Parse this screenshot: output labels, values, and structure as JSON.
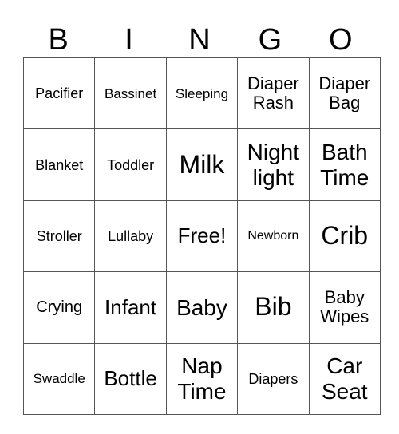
{
  "header": [
    "B",
    "I",
    "N",
    "G",
    "O"
  ],
  "rows": [
    [
      "Pacifier",
      "Bassinet",
      "Sleeping",
      "Diaper Rash",
      "Diaper Bag"
    ],
    [
      "Blanket",
      "Toddler",
      "Milk",
      "Night light",
      "Bath Time"
    ],
    [
      "Stroller",
      "Lullaby",
      "Free!",
      "Newborn",
      "Crib"
    ],
    [
      "Crying",
      "Infant",
      "Baby",
      "Bib",
      "Baby Wipes"
    ],
    [
      "Swaddle",
      "Bottle",
      "Nap Time",
      "Diapers",
      "Car Seat"
    ]
  ]
}
